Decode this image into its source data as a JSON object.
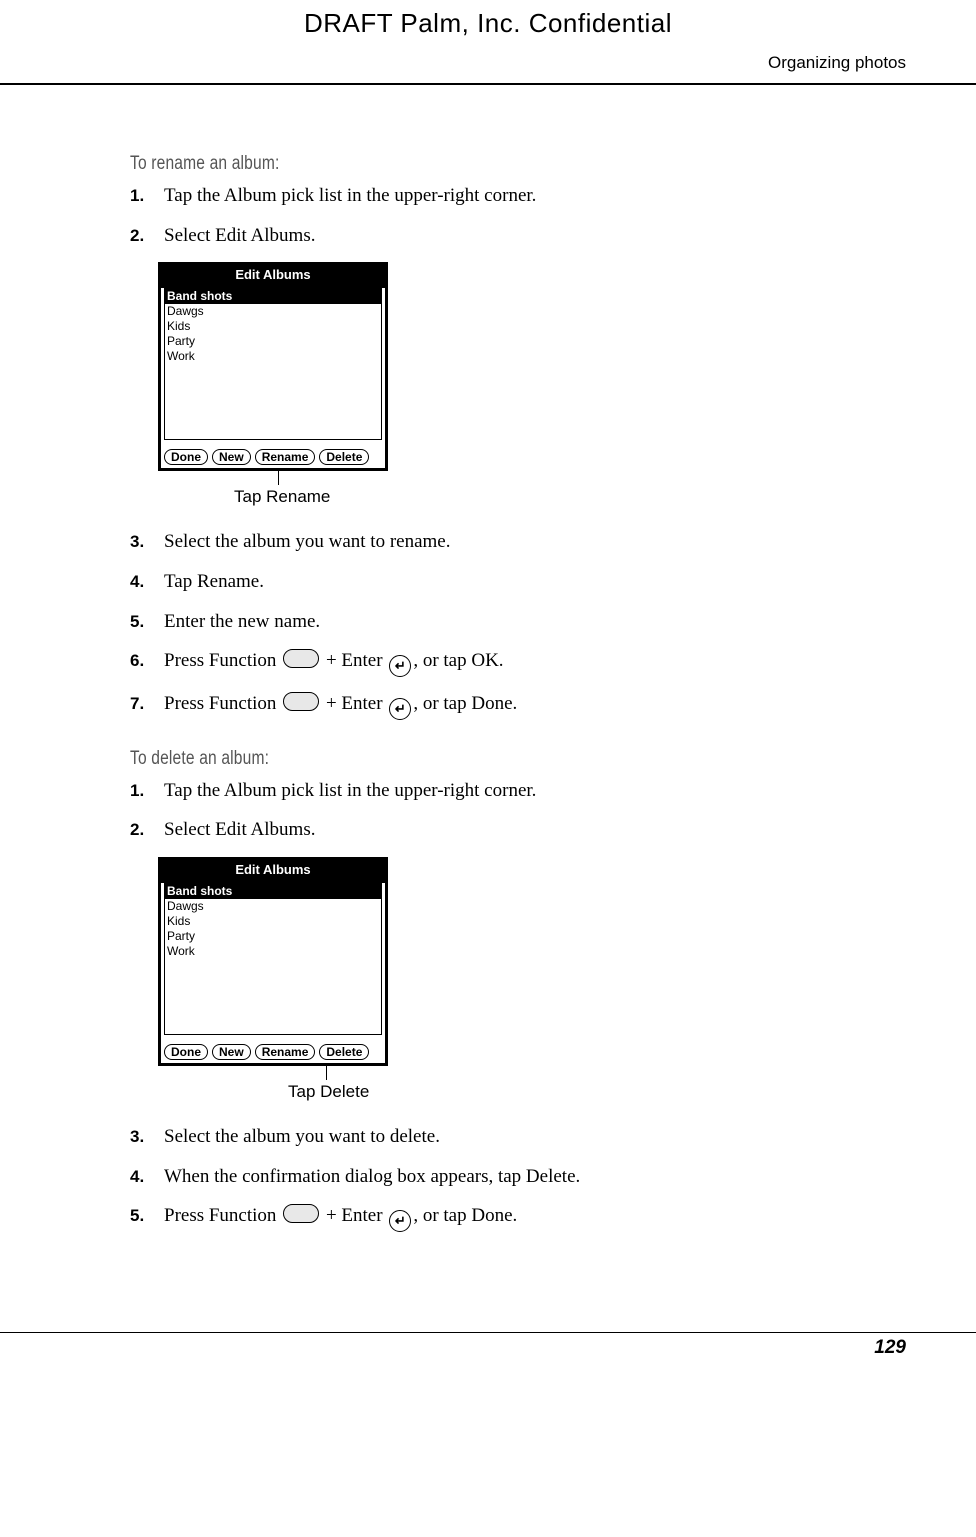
{
  "header": {
    "draft": "DRAFT   Palm, Inc. Confidential",
    "running_head": "Organizing photos"
  },
  "section1": {
    "title": "To rename an album:",
    "steps": [
      "Tap the Album pick list in the upper-right corner.",
      "Select Edit Albums."
    ],
    "fig": {
      "title": "Edit Albums",
      "items": [
        "Band shots",
        "Dawgs",
        "Kids",
        "Party",
        "Work"
      ],
      "btns": [
        "Done",
        "New",
        "Rename",
        "Delete"
      ],
      "callout": "Tap Rename"
    },
    "steps2": [
      "Select the album you want to rename.",
      "Tap Rename.",
      "Enter the new name."
    ],
    "step6_a": "Press Function ",
    "step6_b": " + Enter ",
    "step6_c": ", or tap OK.",
    "step7_a": "Press Function ",
    "step7_b": " + Enter ",
    "step7_c": ", or tap Done."
  },
  "section2": {
    "title": "To delete an album:",
    "steps": [
      "Tap the Album pick list in the upper-right corner.",
      "Select Edit Albums."
    ],
    "fig": {
      "title": "Edit Albums",
      "items": [
        "Band shots",
        "Dawgs",
        "Kids",
        "Party",
        "Work"
      ],
      "btns": [
        "Done",
        "New",
        "Rename",
        "Delete"
      ],
      "callout": "Tap Delete"
    },
    "steps2": [
      "Select the album you want to delete.",
      "When the confirmation dialog box appears, tap Delete."
    ],
    "step5_a": "Press Function ",
    "step5_b": " + Enter ",
    "step5_c": ", or tap Done."
  },
  "footer": {
    "page": "129"
  },
  "enter_glyph": "↵"
}
